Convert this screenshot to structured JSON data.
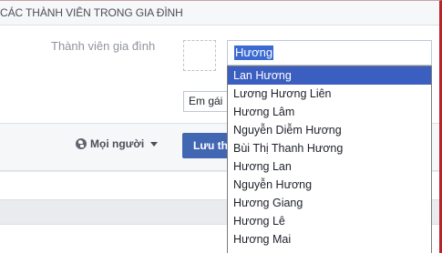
{
  "header": {
    "title": "CÁC THÀNH VIÊN TRONG GIA ĐÌNH"
  },
  "form": {
    "field_label": "Thành viên gia đình",
    "name_value": "Hương",
    "relation_value": "Em gái"
  },
  "toolbar": {
    "privacy_label": "Mọi người",
    "save_label": "Lưu th"
  },
  "autocomplete": {
    "items": [
      "Lan Hương",
      "Lương Hương Liên",
      "Hương Lâm",
      "Nguyễn Diễm Hương",
      "Bùi Thị Thanh Hương",
      "Hương Lan",
      "Nguyễn Hương",
      "Hương Giang",
      "Hương Lê",
      "Hương Mai"
    ],
    "selected_index": 0
  },
  "colors": {
    "accent": "#4267b2",
    "selection": "#3b5fc0",
    "frame": "#b8232a"
  }
}
